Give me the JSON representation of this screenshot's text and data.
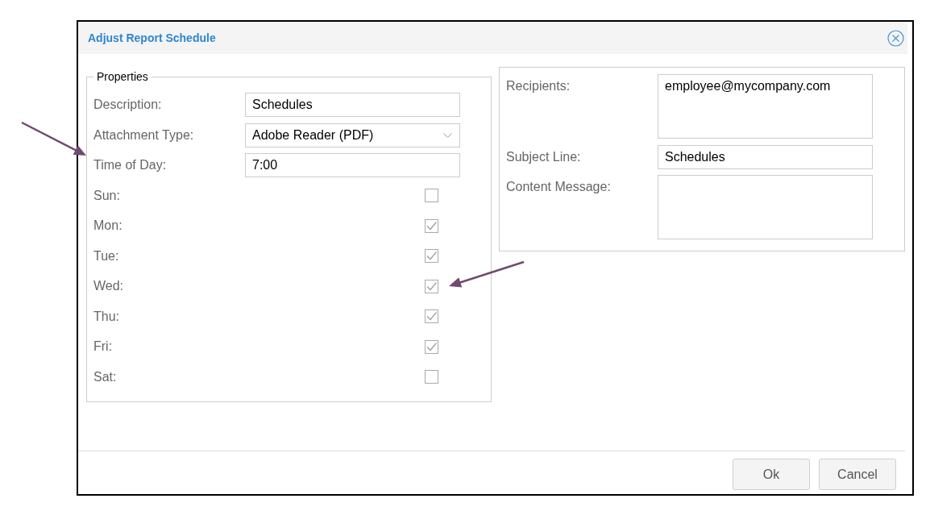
{
  "dialog": {
    "title": "Adjust Report Schedule"
  },
  "properties": {
    "legend": "Properties",
    "fields": [
      {
        "kind": "text",
        "label": "Description:",
        "value": "Schedules"
      },
      {
        "kind": "select",
        "label": "Attachment Type:",
        "value": "Adobe Reader (PDF)"
      },
      {
        "kind": "text",
        "label": "Time of Day:",
        "value": "7:00"
      }
    ],
    "days": [
      {
        "label": "Sun:",
        "checked": false
      },
      {
        "label": "Mon:",
        "checked": true
      },
      {
        "label": "Tue:",
        "checked": true
      },
      {
        "label": "Wed:",
        "checked": true
      },
      {
        "label": "Thu:",
        "checked": true
      },
      {
        "label": "Fri:",
        "checked": true
      },
      {
        "label": "Sat:",
        "checked": false
      }
    ]
  },
  "email": {
    "fields": [
      {
        "kind": "textarea",
        "label": "Recipients:",
        "value": "employee@mycompany.com"
      },
      {
        "kind": "text",
        "label": "Subject Line:",
        "value": "Schedules"
      },
      {
        "kind": "textarea",
        "label": "Content Message:"
      }
    ]
  },
  "buttons": [
    {
      "label": "Ok"
    },
    {
      "label": "Cancel"
    }
  ]
}
